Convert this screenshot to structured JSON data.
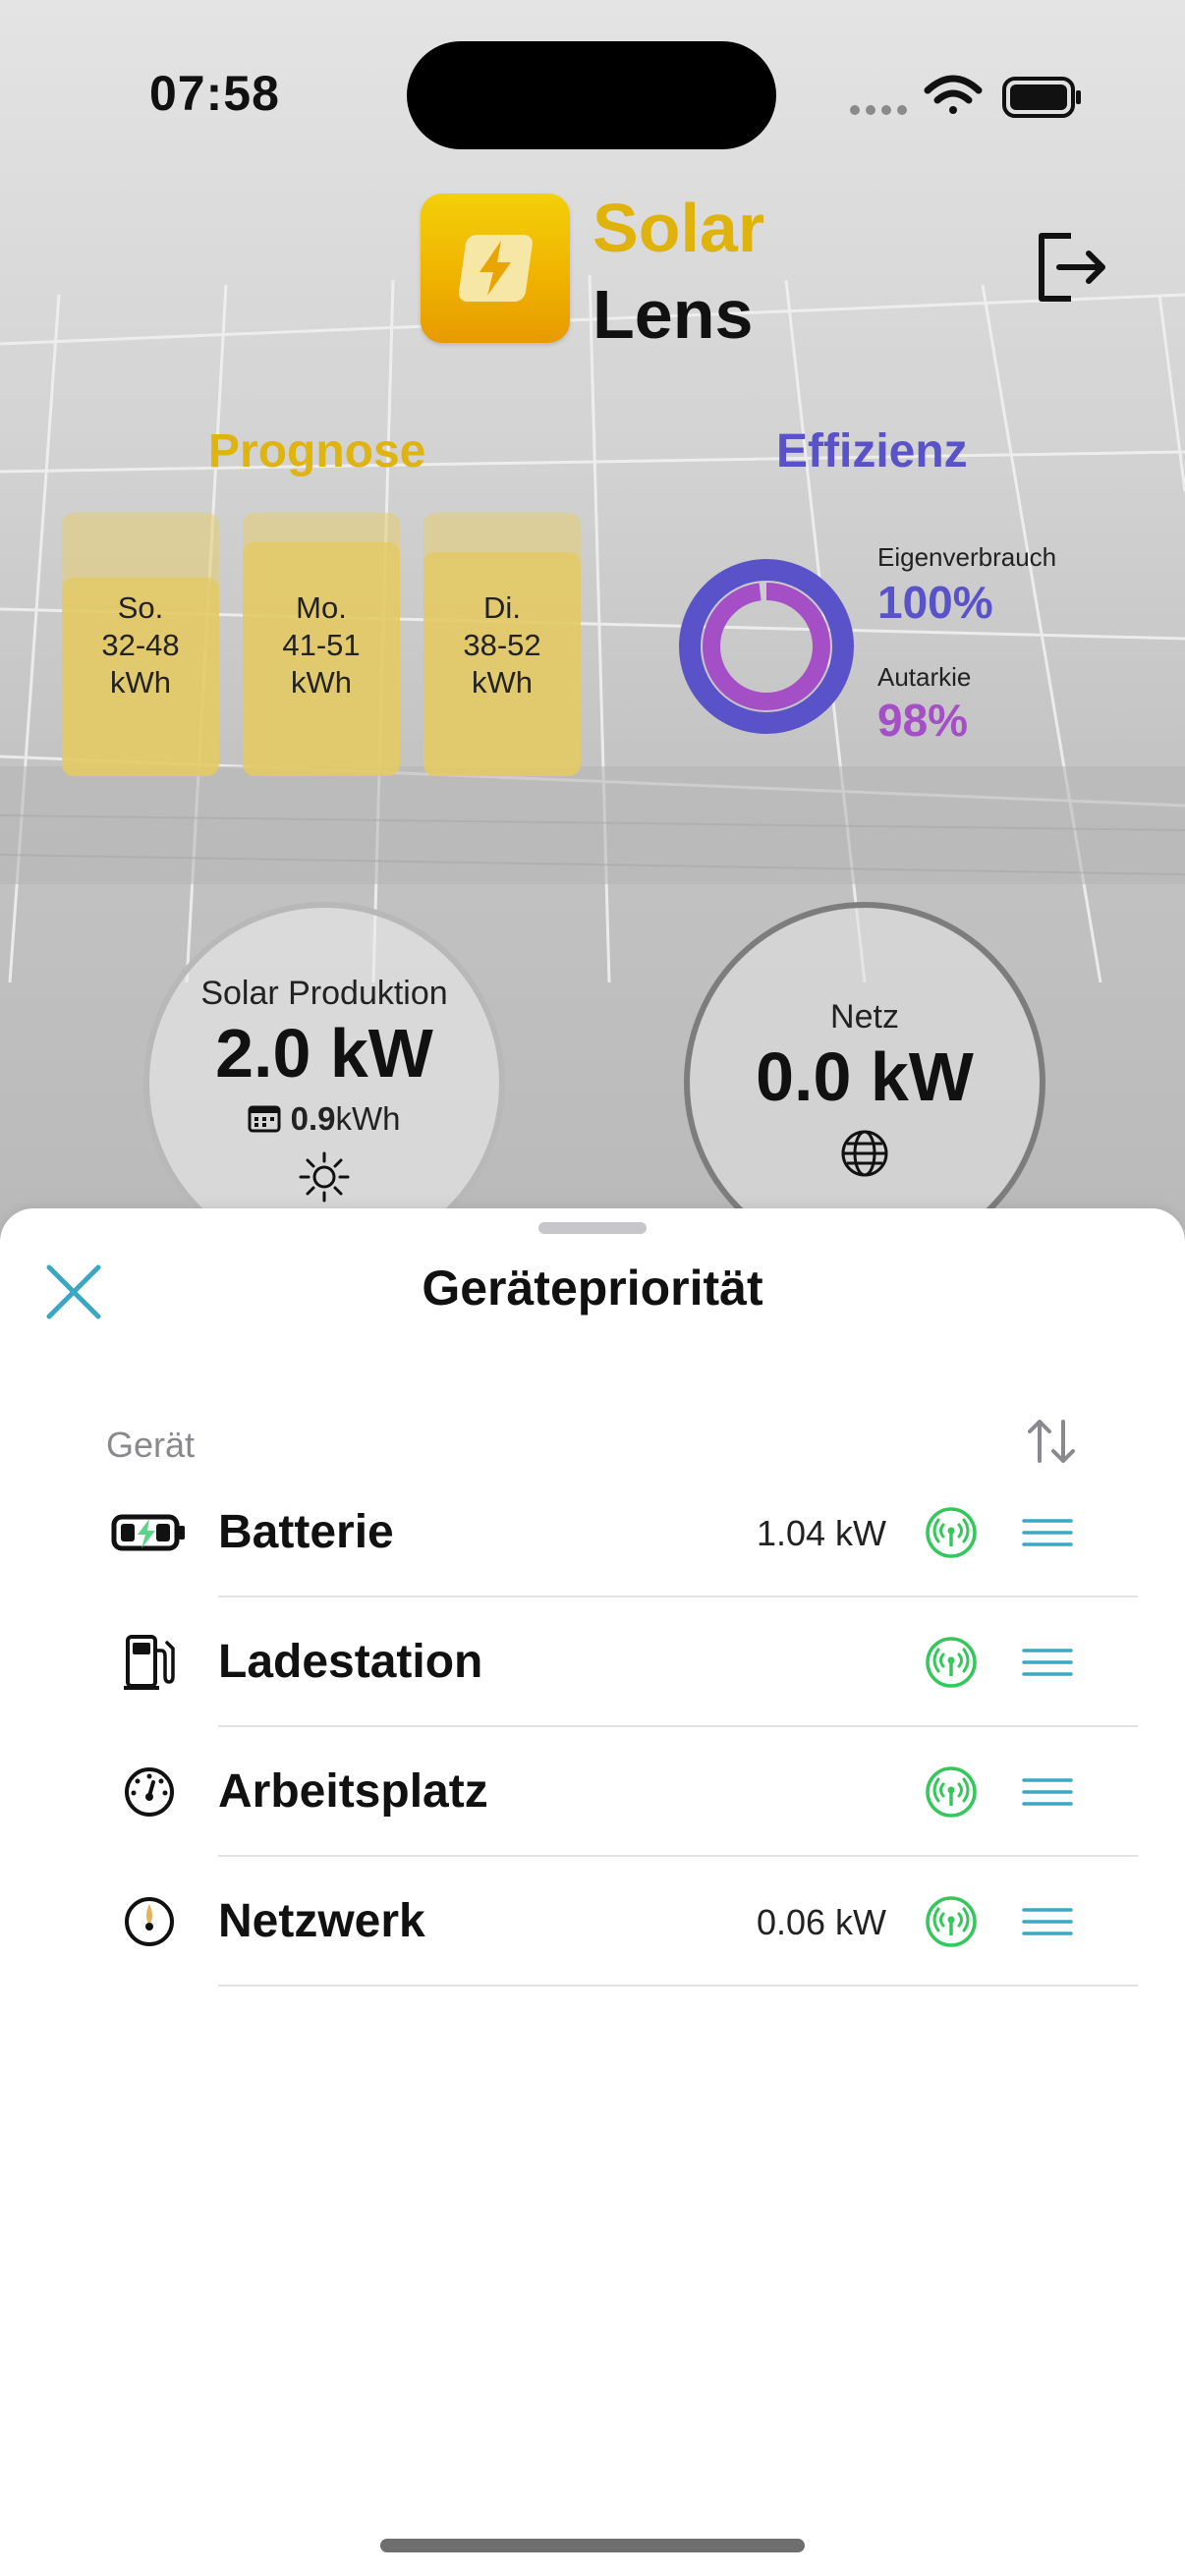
{
  "status": {
    "time": "07:58"
  },
  "app": {
    "logo_top": "Solar",
    "logo_bottom": "Lens"
  },
  "forecast": {
    "title": "Prognose",
    "days": [
      {
        "day": "So.",
        "range": "32-48",
        "unit": "kWh"
      },
      {
        "day": "Mo.",
        "range": "41-51",
        "unit": "kWh"
      },
      {
        "day": "Di.",
        "range": "38-52",
        "unit": "kWh"
      }
    ]
  },
  "efficiency": {
    "title": "Effizienz",
    "self_consumption_label": "Eigenverbrauch",
    "self_consumption_value": "100%",
    "autarky_label": "Autarkie",
    "autarky_value": "98%"
  },
  "solar": {
    "caption": "Solar Produktion",
    "power": "2.0 kW",
    "energy": "0.9",
    "energy_unit": "kWh"
  },
  "grid": {
    "caption": "Netz",
    "power": "0.0 kW"
  },
  "sheet": {
    "title": "Gerätepriorität",
    "column_device": "Gerät",
    "devices": [
      {
        "name": "Batterie",
        "power": "1.04 kW",
        "icon": "battery-charging-icon"
      },
      {
        "name": "Ladestation",
        "power": "",
        "icon": "fuel-pump-icon"
      },
      {
        "name": "Arbeitsplatz",
        "power": "",
        "icon": "gauge-icon"
      },
      {
        "name": "Netzwerk",
        "power": "0.06 kW",
        "icon": "gauge-icon"
      }
    ]
  },
  "colors": {
    "solar_yellow": "#E0B30C",
    "efficiency_blue": "#5A52C8",
    "autarky_purple": "#A44FC6",
    "signal_green": "#34C759",
    "drag_teal": "#3AA7C4"
  }
}
